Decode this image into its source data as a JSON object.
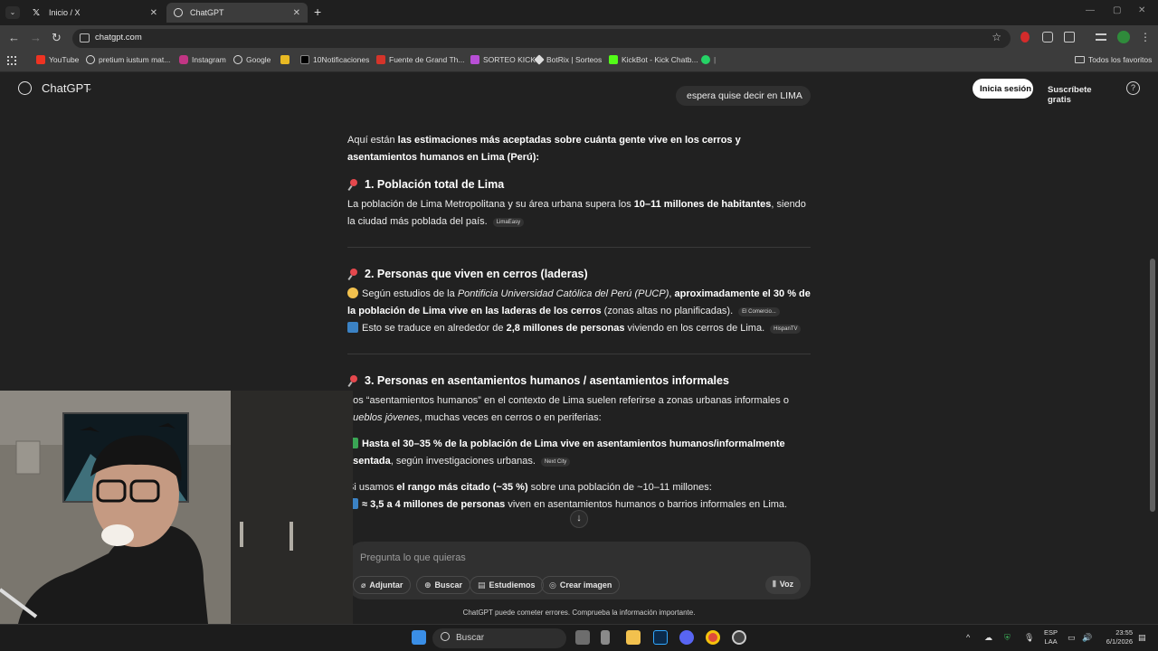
{
  "browser": {
    "tabs": [
      {
        "label": "Inicio / X",
        "icon": "x-logo-icon"
      },
      {
        "label": "ChatGPT",
        "icon": "chatgpt-logo-icon"
      }
    ],
    "url": "chatgpt.com",
    "bookmarks": [
      "YouTube",
      "pretium iustum mat...",
      "Instagram",
      "Google",
      "10Notificaciones",
      "Fuente de Grand Th...",
      "SORTEO KICK",
      "BotRix | Sorteos",
      "KickBot - Kick Chatb..."
    ],
    "bookmarks_folder": "Todos los favoritos"
  },
  "header": {
    "brand": "ChatGPT",
    "user_message": "espera quise decir en LIMA",
    "login": "Inicia sesión",
    "signup": "Suscríbete gratis",
    "help": "?"
  },
  "answer": {
    "intro_plain": "Aquí están ",
    "intro_bold": "las estimaciones más aceptadas sobre cuánta gente vive en los cerros y asentamientos humanos en Lima (Perú):",
    "s1_title": "1. Población total de Lima",
    "s1_a": "La población de Lima Metropolitana y su área urbana supera los ",
    "s1_b": "10–11 millones de habitantes",
    "s1_c": ", siendo la ciudad más poblada del país.",
    "s1_chip": "LimaEasy",
    "s2_title": "2. Personas que viven en cerros (laderas)",
    "s2_a": "Según estudios de la ",
    "s2_b": "Pontificia Universidad Católica del Perú (PUCP)",
    "s2_c": ", ",
    "s2_d": "aproximadamente el 30 % de la población de Lima vive en las laderas de los cerros",
    "s2_e": " (zonas altas no planificadas).",
    "s2_chip": "El Comercio...",
    "s2_f": "Esto se traduce en alrededor de ",
    "s2_g": "2,8 millones de personas",
    "s2_h": " viviendo en los cerros de Lima.",
    "s2_chip2": "HispanTV",
    "s3_title": "3. Personas en asentamientos humanos / asentamientos informales",
    "s3_a": "Los “asentamientos humanos” en el contexto de Lima suelen referirse a zonas urbanas informales o ",
    "s3_b": "pueblos jóvenes",
    "s3_c": ", muchas veces en cerros o en periferias:",
    "s3_d": "Hasta el 30–35 % de la población de Lima vive en asentamientos humanos/informalmente asentada",
    "s3_e": ", según investigaciones urbanas.",
    "s3_chip": "Next City",
    "s3_f": "Si usamos ",
    "s3_g": "el rango más citado (~35 %)",
    "s3_h": " sobre una población de ~10–11 millones:",
    "s3_i": "≈ 3,5 a 4 millones de personas",
    "s3_j": " viven en asentamientos humanos o barrios informales en Lima."
  },
  "composer": {
    "placeholder": "Pregunta lo que quieras",
    "attach": "Adjuntar",
    "search": "Buscar",
    "study": "Estudiemos",
    "image": "Crear imagen",
    "voice": "Voz"
  },
  "disclaimer": "ChatGPT puede cometer errores. Comprueba la información importante.",
  "taskbar": {
    "search": "Buscar",
    "lang1": "ESP",
    "lang2": "LAA",
    "time": "23:55",
    "date": "6/1/2026"
  }
}
